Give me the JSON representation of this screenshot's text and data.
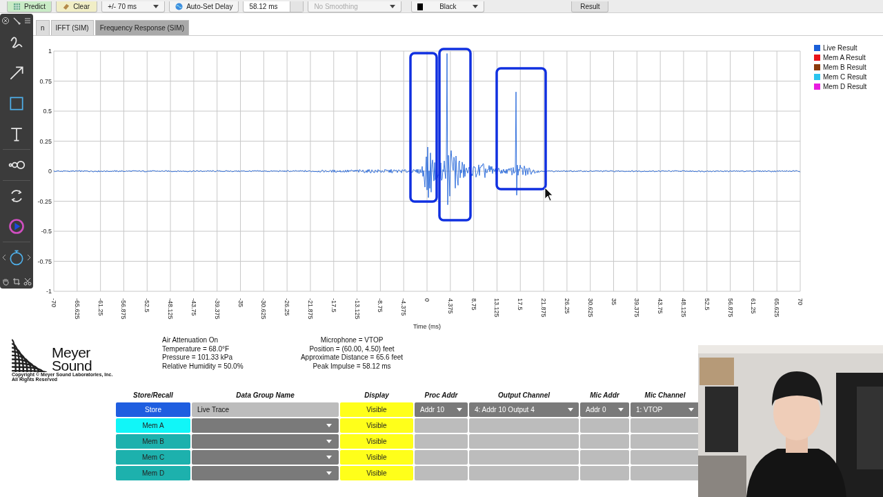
{
  "toolbar": [
    {
      "kind": "predict",
      "label": "Predict",
      "color": "#c9ebc6"
    },
    {
      "kind": "clear",
      "label": "Clear",
      "color": "#f1eec6"
    },
    {
      "kind": "dropdown",
      "label": "+/- 70 ms",
      "disabled": false
    },
    {
      "kind": "autoset",
      "label": "Auto-Set Delay"
    },
    {
      "kind": "spinner",
      "label": "58.12 ms"
    },
    {
      "kind": "dropdown",
      "label": "No Smoothing",
      "disabled": true
    },
    {
      "kind": "swatch",
      "label": "Black",
      "color": "#000000"
    },
    {
      "kind": "result",
      "label": "Result"
    }
  ],
  "tabs": [
    {
      "label": "n",
      "selected": false
    },
    {
      "label": "IFFT (SIM)",
      "selected": false
    },
    {
      "label": "Frequency Response (SIM)",
      "selected": true
    }
  ],
  "tool_palette": [
    {
      "kind": "squiggle",
      "selected": false
    },
    {
      "kind": "arrow",
      "selected": false
    },
    {
      "kind": "rectangle",
      "selected": true
    },
    {
      "kind": "text",
      "selected": false
    },
    {
      "kind": "sizes",
      "selected": false
    },
    {
      "kind": "rotate",
      "selected": false
    },
    {
      "kind": "color",
      "selected": false
    },
    {
      "kind": "timer",
      "selected": true
    }
  ],
  "chart": {
    "y_labels": [
      "1",
      "0.75",
      "0.5",
      "0.25",
      "0",
      "-0.25",
      "-0.5",
      "-0.75",
      "-1"
    ],
    "x_labels": [
      "-70",
      "-65.625",
      "-61.25",
      "-56.875",
      "-52.5",
      "-48.125",
      "-43.75",
      "-39.375",
      "-35",
      "-30.625",
      "-26.25",
      "-21.875",
      "-17.5",
      "-13.125",
      "-8.75",
      "-4.375",
      "0",
      "4.375",
      "8.75",
      "13.125",
      "17.5",
      "21.875",
      "26.25",
      "30.625",
      "35",
      "39.375",
      "43.75",
      "48.125",
      "52.5",
      "56.875",
      "61.25",
      "65.625",
      "70"
    ],
    "x_label": "Time (ms)",
    "legend": [
      {
        "label": "Live Result",
        "color": "#1a5fd8"
      },
      {
        "label": "Mem A Result",
        "color": "#e8131a"
      },
      {
        "label": "Mem B Result",
        "color": "#8a3a0c"
      },
      {
        "label": "Mem C Result",
        "color": "#2bc4ee"
      },
      {
        "label": "Mem D Result",
        "color": "#e81ce0"
      }
    ]
  },
  "logo": {
    "line_1": "Meyer",
    "line_2": "Sound",
    "copyright": "Copyright © Meyer Sound Laboratories, Inc.",
    "rights": "All Rights Reserved"
  },
  "conditions": [
    "Air Attenuation On",
    "Temperature = 68.0°F",
    "Pressure = 101.33  kPa",
    "Relative Humidity = 50.0%"
  ],
  "microphone": [
    "Microphone = VTOP",
    "Position = (60.00, 4.50) feet",
    "Approximate Distance = 65.6 feet",
    "Peak Impulse = 58.12 ms"
  ],
  "table": {
    "columns": [
      "Store/Recall",
      "Data Group Name",
      "Display",
      "Proc Addr",
      "Output Channel",
      "Mic Addr",
      "Mic Channel"
    ],
    "rows": [
      {
        "kind": "store",
        "button": "Store",
        "color": "#1f5ee0",
        "name": "Live Trace",
        "display": "Visible",
        "proc_addr": "Addr 10",
        "output_channel": "4: Addr 10 Output 4",
        "mic_addr": "Addr 0",
        "mic_channel": "1: VTOP"
      },
      {
        "kind": "mem",
        "button": "Mem A",
        "color": "#11f6f8",
        "display": "Visible"
      },
      {
        "kind": "mem",
        "button": "Mem B",
        "color": "#1db1ad",
        "display": "Visible"
      },
      {
        "kind": "mem",
        "button": "Mem C",
        "color": "#1db1ad",
        "display": "Visible"
      },
      {
        "kind": "mem",
        "button": "Mem D",
        "color": "#1db1ad",
        "display": "Visible"
      }
    ]
  },
  "webcam": {
    "kind": "picture"
  }
}
